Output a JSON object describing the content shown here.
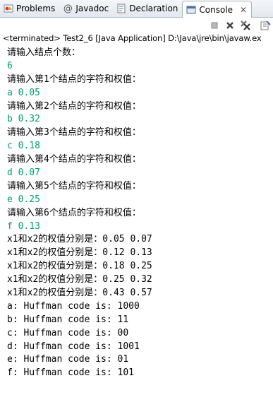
{
  "tabs": [
    {
      "label": "Problems",
      "icon": "problems-icon",
      "active": false
    },
    {
      "label": "Javadoc",
      "icon": "at-icon",
      "active": false
    },
    {
      "label": "Declaration",
      "icon": "declaration-icon",
      "active": false
    },
    {
      "label": "Console",
      "icon": "console-icon",
      "active": true,
      "close": "✕"
    }
  ],
  "toolbar": {
    "buttons": [
      "terminate-icon",
      "remove-launch-icon",
      "remove-all-terminated-icon",
      "console-options-icon"
    ]
  },
  "status": "<terminated> Test2_6 [Java Application] D:\\Java\\jre\\bin\\javaw.ex",
  "colors": {
    "output": "#000000",
    "input": "#00a070"
  },
  "console_lines": [
    {
      "text": "请输入结点个数：",
      "kind": "out"
    },
    {
      "text": "6",
      "kind": "in"
    },
    {
      "text": "请输入第1个结点的字符和权值：",
      "kind": "out"
    },
    {
      "text": "a 0.05",
      "kind": "in"
    },
    {
      "text": "请输入第2个结点的字符和权值：",
      "kind": "out"
    },
    {
      "text": "b 0.32",
      "kind": "in"
    },
    {
      "text": "请输入第3个结点的字符和权值：",
      "kind": "out"
    },
    {
      "text": "c 0.18",
      "kind": "in"
    },
    {
      "text": "请输入第4个结点的字符和权值：",
      "kind": "out"
    },
    {
      "text": "d 0.07",
      "kind": "in"
    },
    {
      "text": "请输入第5个结点的字符和权值：",
      "kind": "out"
    },
    {
      "text": "e 0.25",
      "kind": "in"
    },
    {
      "text": "请输入第6个结点的字符和权值：",
      "kind": "out"
    },
    {
      "text": "f 0.13",
      "kind": "in"
    },
    {
      "text": "x1和x2的权值分别是：0.05 0.07",
      "kind": "out"
    },
    {
      "text": "x1和x2的权值分别是：0.12 0.13",
      "kind": "out"
    },
    {
      "text": "x1和x2的权值分别是：0.18 0.25",
      "kind": "out"
    },
    {
      "text": "x1和x2的权值分别是：0.25 0.32",
      "kind": "out"
    },
    {
      "text": "x1和x2的权值分别是：0.43 0.57",
      "kind": "out"
    },
    {
      "text": "a: Huffman code is: 1000",
      "kind": "out"
    },
    {
      "text": "b: Huffman code is: 11",
      "kind": "out"
    },
    {
      "text": "c: Huffman code is: 00",
      "kind": "out"
    },
    {
      "text": "d: Huffman code is: 1001",
      "kind": "out"
    },
    {
      "text": "e: Huffman code is: 01",
      "kind": "out"
    },
    {
      "text": "f: Huffman code is: 101",
      "kind": "out"
    }
  ]
}
